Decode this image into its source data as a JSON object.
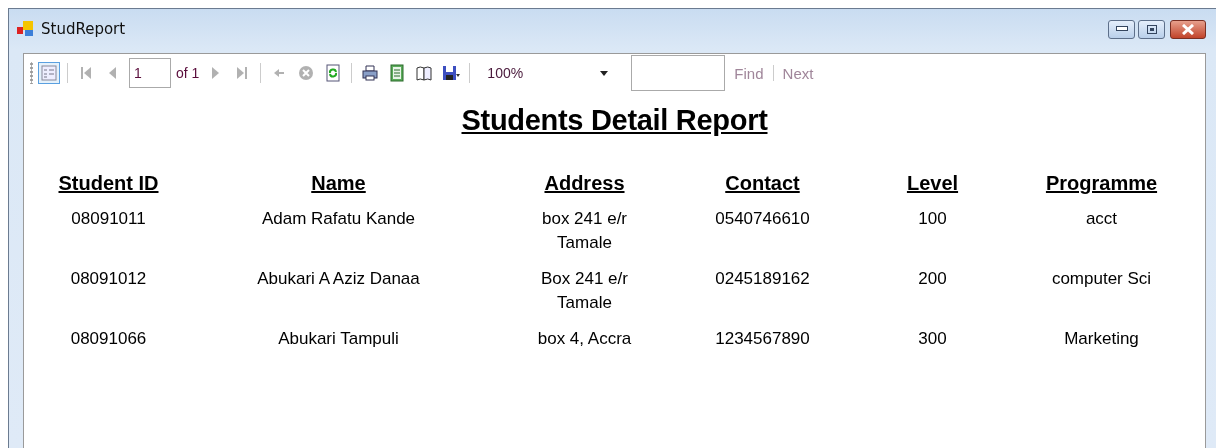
{
  "window": {
    "title": "StudReport"
  },
  "toolbar": {
    "items": [
      {
        "kind": "toc",
        "selected": true,
        "disabled": false
      },
      {
        "kind": "sep"
      },
      {
        "kind": "first",
        "disabled": true
      },
      {
        "kind": "prev",
        "disabled": true
      },
      {
        "kind": "page",
        "value": "1",
        "of": "of 1"
      },
      {
        "kind": "next",
        "disabled": true
      },
      {
        "kind": "last",
        "disabled": true
      },
      {
        "kind": "sep"
      },
      {
        "kind": "back",
        "disabled": true
      },
      {
        "kind": "stop",
        "disabled": true
      },
      {
        "kind": "refresh",
        "disabled": false
      },
      {
        "kind": "sep"
      },
      {
        "kind": "print",
        "disabled": false
      },
      {
        "kind": "layout",
        "disabled": false
      },
      {
        "kind": "setup",
        "disabled": false
      },
      {
        "kind": "save",
        "disabled": false
      },
      {
        "kind": "sep"
      },
      {
        "kind": "zoom",
        "value": "100%"
      },
      {
        "kind": "find",
        "find": "Find",
        "next": "Next",
        "disabled": true
      }
    ]
  },
  "report": {
    "title": "Students Detail Report",
    "columns": [
      "Student ID",
      "Name",
      "Address",
      "Contact",
      "Level",
      "Programme"
    ],
    "rows": [
      [
        "08091011",
        "Adam Rafatu Kande",
        "box 241 e/r Tamale",
        "0540746610",
        "100",
        "acct"
      ],
      [
        "08091012",
        "Abukari A Aziz Danaa",
        "Box 241 e/r Tamale",
        "0245189162",
        "200",
        "computer Sci"
      ],
      [
        "08091066",
        "Abukari Tampuli",
        "box 4, Accra",
        "1234567890",
        "300",
        "Marketing"
      ]
    ]
  }
}
